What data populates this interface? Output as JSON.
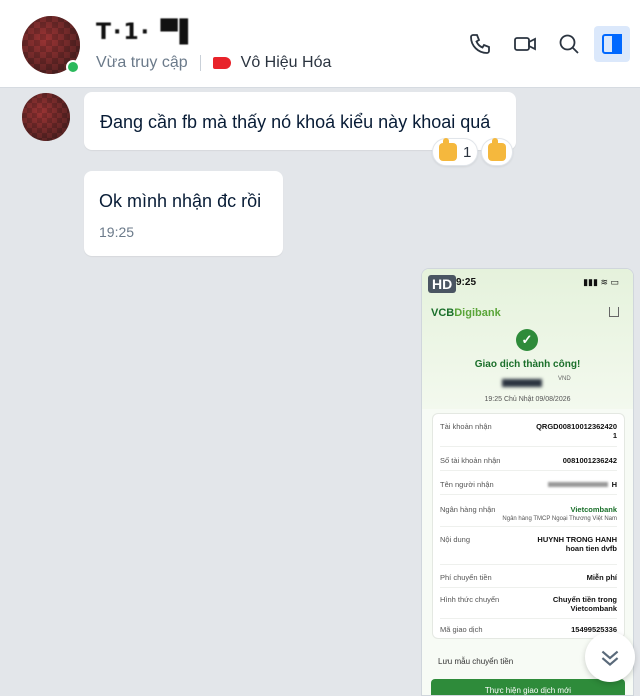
{
  "header": {
    "contact_name": "T·1·  ▀▌",
    "status": "Vừa truy cập",
    "tag_label": "Vô Hiệu Hóa",
    "tag_color": "#e8232a",
    "icons": [
      "phone-icon",
      "video-call-icon",
      "search-icon",
      "sidebar-toggle-icon"
    ]
  },
  "messages": [
    {
      "text": "Đang cần fb mà thấy nó khoá kiểu này khoai quá",
      "reactions": [
        {
          "icon": "thumbs-up-icon",
          "count": "1"
        },
        {
          "icon": "thumbs-up-icon",
          "count": ""
        }
      ]
    },
    {
      "text": "Ok mình nhận đc rồi",
      "time": "19:25"
    }
  ],
  "image_message": {
    "hd_badge": "HD",
    "clock": "9:25",
    "bank_brand_a": "VCB",
    "bank_brand_b": "Digibank",
    "success": "Giao dịch thành công!",
    "currency": "VND",
    "datetime": "19:25 Chủ Nhật 09/08/2026",
    "details": [
      {
        "label": "Tài khoản nhận",
        "value": "QRGD00810012362420\n1"
      },
      {
        "label": "Số tài khoản nhận",
        "value": "0081001236242"
      },
      {
        "label": "Tên người nhận",
        "value": "H"
      },
      {
        "label": "Ngân hàng nhận",
        "value": "Vietcombank"
      },
      {
        "label": "Ngân hàng nhận sub",
        "value": "Ngân hàng TMCP Ngoại Thương Việt Nam"
      },
      {
        "label": "Nội dung",
        "value": "HUYNH TRONG HANH\nhoan tien dvfb"
      },
      {
        "label": "Phí chuyển tiền",
        "value": "Miễn phí"
      },
      {
        "label": "Hình thức chuyển",
        "value": "Chuyển tiền trong\nVietcombank"
      },
      {
        "label": "Mã giao dịch",
        "value": "15499525336"
      }
    ],
    "save_label": "Lưu mẫu chuyển tiền",
    "confirm_label": "Thực hiện giao dịch mới"
  },
  "colors": {
    "accent": "#0068ff",
    "bank_green": "#2e8b3a"
  }
}
